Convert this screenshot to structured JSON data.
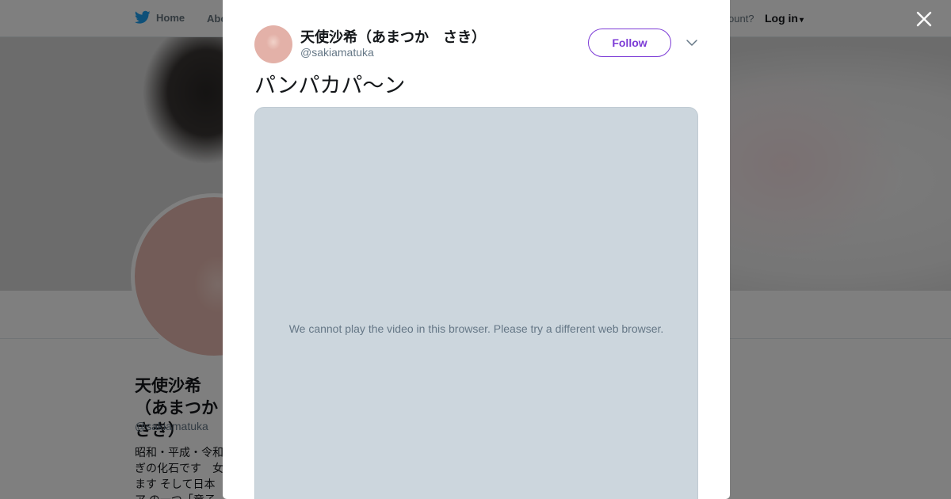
{
  "background_page": {
    "nav": {
      "home_label": "Home",
      "about_label": "Abo",
      "account_prompt": "ccount?",
      "login_label": "Log in"
    },
    "profile": {
      "display_name": "天使沙希（あまつか　さき）",
      "handle": "@sakiamatuka",
      "bio": "昭和・平成・令和 ぎの化石です　女 ます そして日本ア の一つ「童子切安"
    }
  },
  "modal": {
    "author": {
      "display_name": "天使沙希（あまつか　さき）",
      "handle": "@sakiamatuka"
    },
    "follow_label": "Follow",
    "more_icon": "chevron-down-icon",
    "tweet_text": "パンパカパ〜ン",
    "media_message": "We cannot play the video in this browser. Please try a different web browser."
  },
  "icons": {
    "close": "close-icon",
    "bird": "twitter-bird-icon",
    "login_caret": "caret-down-icon"
  },
  "colors": {
    "accent": "#7c3bd6",
    "brand": "#1da1f2",
    "text": "#14171a",
    "muted": "#657786",
    "media_bg": "#ccd6dd"
  }
}
